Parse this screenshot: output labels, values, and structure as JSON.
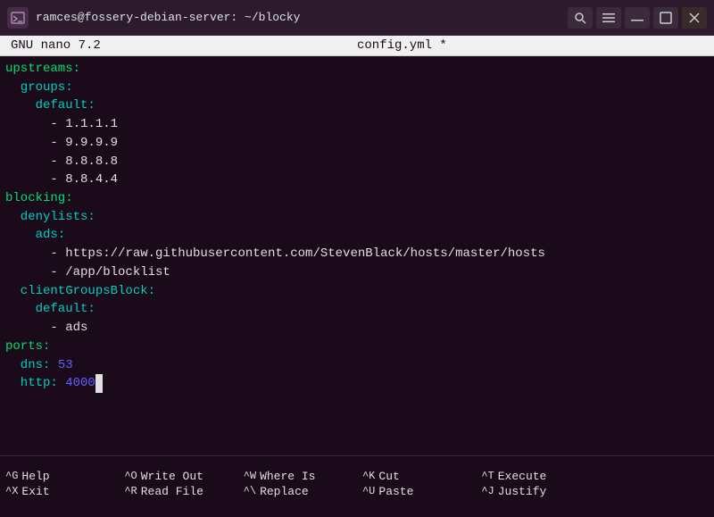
{
  "titlebar": {
    "title": "ramces@fossery-debian-server: ~/blocky",
    "icon": "⬛"
  },
  "nano_header": {
    "version": "GNU nano 7.2",
    "filename": "config.yml *"
  },
  "editor": {
    "lines": [
      {
        "text": "upstreams:",
        "parts": [
          {
            "text": "upstreams:",
            "color": "green"
          }
        ]
      },
      {
        "text": "  groups:",
        "parts": [
          {
            "text": "  groups:",
            "color": "cyan"
          }
        ]
      },
      {
        "text": "    default:",
        "parts": [
          {
            "text": "    default:",
            "color": "cyan"
          }
        ]
      },
      {
        "text": "      - 1.1.1.1",
        "parts": [
          {
            "text": "      - ",
            "color": "white"
          },
          {
            "text": "1.1.1.1",
            "color": "white"
          }
        ]
      },
      {
        "text": "      - 9.9.9.9",
        "parts": [
          {
            "text": "      - ",
            "color": "white"
          },
          {
            "text": "9.9.9.9",
            "color": "white"
          }
        ]
      },
      {
        "text": "      - 8.8.8.8",
        "parts": [
          {
            "text": "      - ",
            "color": "white"
          },
          {
            "text": "8.8.8.8",
            "color": "white"
          }
        ]
      },
      {
        "text": "      - 8.8.4.4",
        "parts": [
          {
            "text": "      - ",
            "color": "white"
          },
          {
            "text": "8.8.4.4",
            "color": "white"
          }
        ]
      },
      {
        "text": "blocking:",
        "parts": [
          {
            "text": "blocking:",
            "color": "green"
          }
        ]
      },
      {
        "text": "  denylists:",
        "parts": [
          {
            "text": "  denylists:",
            "color": "cyan"
          }
        ]
      },
      {
        "text": "    ads:",
        "parts": [
          {
            "text": "    ads:",
            "color": "cyan"
          }
        ]
      },
      {
        "text": "      - https://raw.githubusercontent.com/StevenBlack/hosts/master/hosts",
        "parts": [
          {
            "text": "      - ",
            "color": "white"
          },
          {
            "text": "https://raw.githubusercontent.com/StevenBlack/hosts/master/hosts",
            "color": "white"
          }
        ]
      },
      {
        "text": "      - /app/blocklist",
        "parts": [
          {
            "text": "      - ",
            "color": "white"
          },
          {
            "text": "/app/blocklist",
            "color": "white"
          }
        ]
      },
      {
        "text": "  clientGroupsBlock:",
        "parts": [
          {
            "text": "  clientGroupsBlock:",
            "color": "cyan"
          }
        ]
      },
      {
        "text": "    default:",
        "parts": [
          {
            "text": "    default:",
            "color": "cyan"
          }
        ]
      },
      {
        "text": "      - ads",
        "parts": [
          {
            "text": "      - ",
            "color": "white"
          },
          {
            "text": "ads",
            "color": "white"
          }
        ]
      },
      {
        "text": "ports:",
        "parts": [
          {
            "text": "ports:",
            "color": "green"
          }
        ]
      },
      {
        "text": "  dns: 53",
        "parts": [
          {
            "text": "  dns: ",
            "color": "cyan"
          },
          {
            "text": "53",
            "color": "blue"
          }
        ]
      },
      {
        "text": "  http: 4000",
        "parts": [
          {
            "text": "  http: ",
            "color": "cyan"
          },
          {
            "text": "4000",
            "color": "blue"
          }
        ],
        "cursor": true
      }
    ]
  },
  "shortcuts": [
    {
      "row1_key": "^G",
      "row1_label": "Help",
      "row2_key": "^X",
      "row2_label": "Exit"
    },
    {
      "row1_key": "^O",
      "row1_label": "Write Out",
      "row2_key": "^R",
      "row2_label": "Read File"
    },
    {
      "row1_key": "^W",
      "row1_label": "Where Is",
      "row2_key": "^\\",
      "row2_label": "Replace"
    },
    {
      "row1_key": "^K",
      "row1_label": "Cut",
      "row2_key": "^U",
      "row2_label": "Paste"
    },
    {
      "row1_key": "^T",
      "row1_label": "Execute",
      "row2_key": "^J",
      "row2_label": "Justify"
    }
  ]
}
